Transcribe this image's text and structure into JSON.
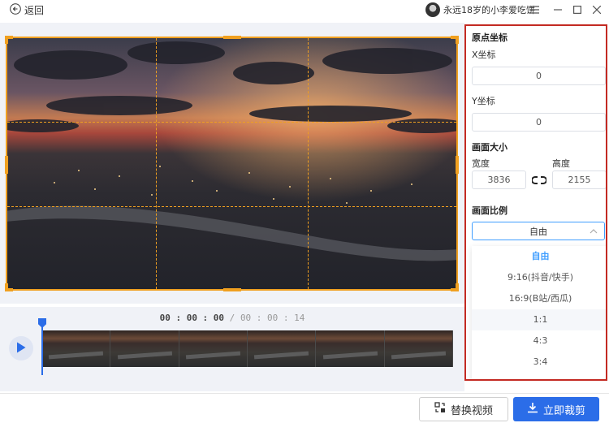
{
  "titlebar": {
    "back_label": "返回",
    "username": "永远18岁的小李爱吃饼"
  },
  "timeline": {
    "current_time": "00 : 00 : 00",
    "separator": " / ",
    "total_time": "00 : 00 : 14",
    "frame_count": 6
  },
  "panel": {
    "origin_title": "原点坐标",
    "x_label": "X坐标",
    "x_value": "0",
    "y_label": "Y坐标",
    "y_value": "0",
    "size_title": "画面大小",
    "width_label": "宽度",
    "width_value": "3836",
    "height_label": "高度",
    "height_value": "2155",
    "ratio_title": "画面比例",
    "ratio_selected": "自由",
    "ratio_options": [
      "自由",
      "9:16(抖音/快手)",
      "16:9(B站/西瓜)",
      "1:1",
      "4:3",
      "3:4"
    ]
  },
  "actions": {
    "replace_label": "替换视频",
    "crop_label": "立即裁剪"
  },
  "colors": {
    "accent": "#2b6de8",
    "crop_frame": "#f0a020",
    "panel_border": "#c32a22",
    "selected_option": "#409eff"
  }
}
